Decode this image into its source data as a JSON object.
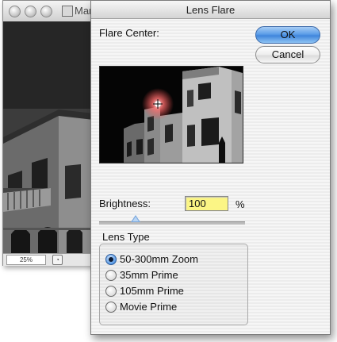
{
  "background_window": {
    "title": "Mar",
    "zoom_level": "25%"
  },
  "dialog": {
    "title": "Lens Flare",
    "flare_center_label": "Flare Center:",
    "ok_label": "OK",
    "cancel_label": "Cancel",
    "brightness": {
      "label": "Brightness:",
      "value": "100",
      "unit": "%",
      "slider_fraction": 0.25
    },
    "lens_type": {
      "label": "Lens Type",
      "options": [
        "50-300mm Zoom",
        "35mm Prime",
        "105mm Prime",
        "Movie Prime"
      ],
      "selected": "50-300mm Zoom"
    }
  },
  "colors": {
    "ok_button": "#5d9ee8",
    "input_highlight": "#fbf585",
    "flare": "#ff6a6a"
  },
  "icons": [
    "close-icon",
    "minimize-icon",
    "zoom-icon",
    "document-icon",
    "status-menu-icon",
    "crosshair-icon"
  ]
}
